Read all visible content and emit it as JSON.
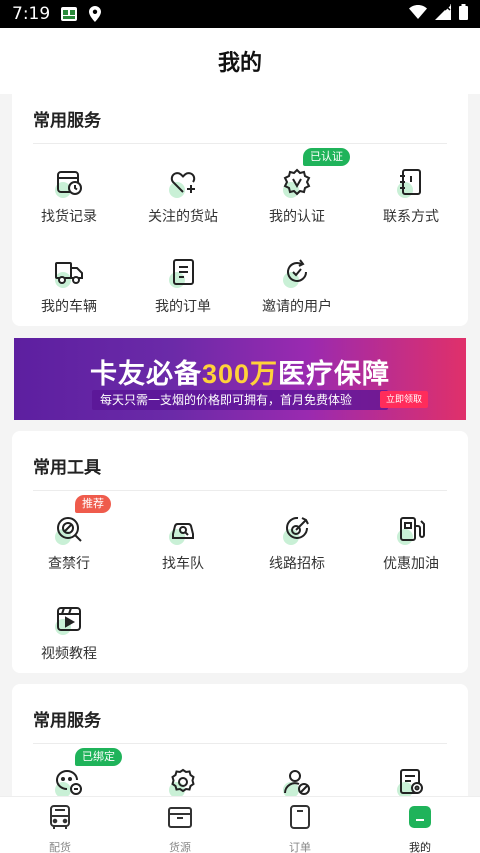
{
  "status_bar": {
    "time": "7:19"
  },
  "header": {
    "title": "我的"
  },
  "section1": {
    "title": "常用服务",
    "items": [
      {
        "label": "找货记录",
        "icon": "cargo-record-icon"
      },
      {
        "label": "关注的货站",
        "icon": "heart-plus-icon"
      },
      {
        "label": "我的认证",
        "icon": "verify-badge-icon",
        "badge": "已认证"
      },
      {
        "label": "联系方式",
        "icon": "contact-book-icon"
      },
      {
        "label": "我的车辆",
        "icon": "truck-icon"
      },
      {
        "label": "我的订单",
        "icon": "order-doc-icon"
      },
      {
        "label": "邀请的用户",
        "icon": "invite-refresh-icon"
      }
    ]
  },
  "banner": {
    "title_a": "卡友必备",
    "title_b": "300万",
    "title_c": "医疗保障",
    "subtitle": "每天只需一支烟的价格即可拥有，首月免费体验",
    "button": "立即领取"
  },
  "section2": {
    "title": "常用工具",
    "items": [
      {
        "label": "查禁行",
        "icon": "no-entry-search-icon",
        "badge": "推荐"
      },
      {
        "label": "找车队",
        "icon": "fleet-car-icon"
      },
      {
        "label": "线路招标",
        "icon": "route-target-icon"
      },
      {
        "label": "优惠加油",
        "icon": "fuel-pump-icon"
      },
      {
        "label": "视频教程",
        "icon": "video-play-icon"
      }
    ]
  },
  "section3": {
    "title": "常用服务",
    "items": [
      {
        "label": "",
        "icon": "wechat-link-icon",
        "badge": "已绑定"
      },
      {
        "label": "",
        "icon": "settings-gear-icon"
      },
      {
        "label": "",
        "icon": "user-block-icon"
      },
      {
        "label": "",
        "icon": "doc-settings-icon"
      }
    ]
  },
  "tabs": [
    {
      "label": "配货",
      "icon": "bus-icon"
    },
    {
      "label": "货源",
      "icon": "box-icon"
    },
    {
      "label": "订单",
      "icon": "order-icon"
    },
    {
      "label": "我的",
      "icon": "profile-icon",
      "active": true
    }
  ],
  "colors": {
    "accent": "#1fb35a",
    "badge_red": "#ef5b4c",
    "text": "#222222"
  }
}
